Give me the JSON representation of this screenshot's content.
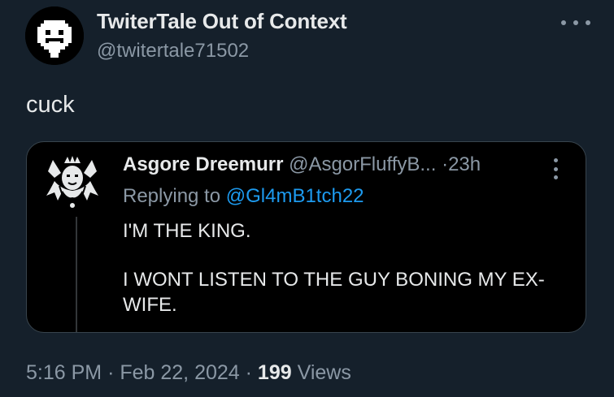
{
  "author": {
    "display_name": "TwiterTale Out of Context",
    "handle": "@twitertale71502",
    "avatar_icon": "pixel-smiley-face-icon"
  },
  "tweet": {
    "text": "cuck"
  },
  "quote": {
    "name": "Asgore Dreemurr",
    "handle": "@AsgorFluffyB...",
    "separator": "·",
    "time": "23h",
    "replying_prefix": "Replying to",
    "replying_to": "@Gl4mB1tch22",
    "lines": [
      "I'M THE KING.",
      "I WONT LISTEN TO THE GUY BONING MY EX-WIFE."
    ],
    "avatar_icon": "horned-king-crest-icon"
  },
  "meta": {
    "time": "5:16 PM",
    "sep1": "·",
    "date": "Feb 22, 2024",
    "sep2": "·",
    "views_count": "199",
    "views_label": "Views"
  },
  "colors": {
    "background": "#15202b",
    "text": "#e7e9ea",
    "muted": "#8b98a5",
    "link": "#1d9bf0",
    "card_background": "#000000",
    "card_border": "#38444d"
  }
}
